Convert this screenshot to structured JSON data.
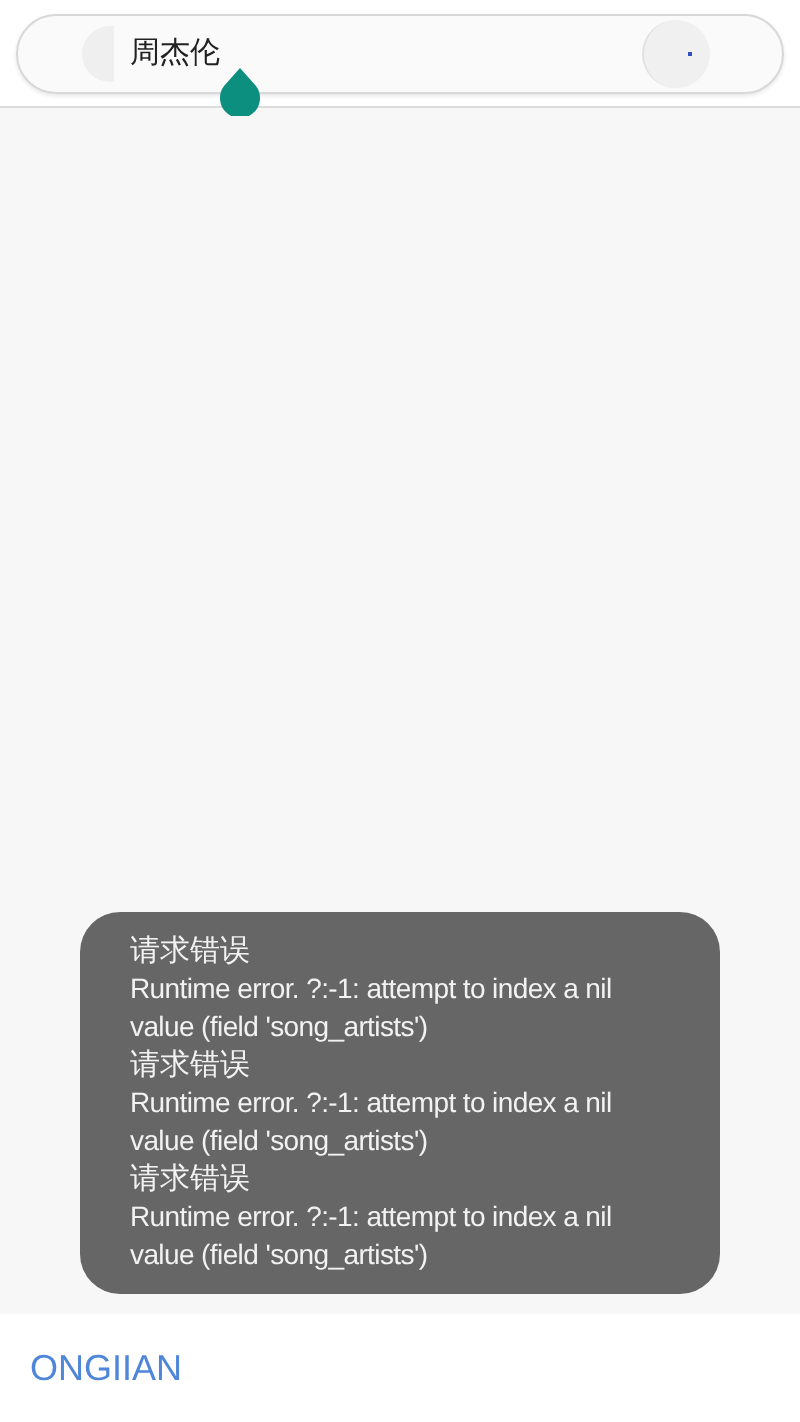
{
  "search": {
    "value": "周杰伦"
  },
  "toast": {
    "messages": [
      {
        "title": "请求错误",
        "detail": "Runtime error. ?:-1: attempt to index a nil value (field 'song_artists')"
      },
      {
        "title": "请求错误",
        "detail": "Runtime error. ?:-1: attempt to index a nil value (field 'song_artists')"
      },
      {
        "title": "请求错误",
        "detail": "Runtime error. ?:-1: attempt to index a nil value (field 'song_artists')"
      }
    ]
  },
  "bottom_bar": {
    "button": "ONGIIAN"
  }
}
